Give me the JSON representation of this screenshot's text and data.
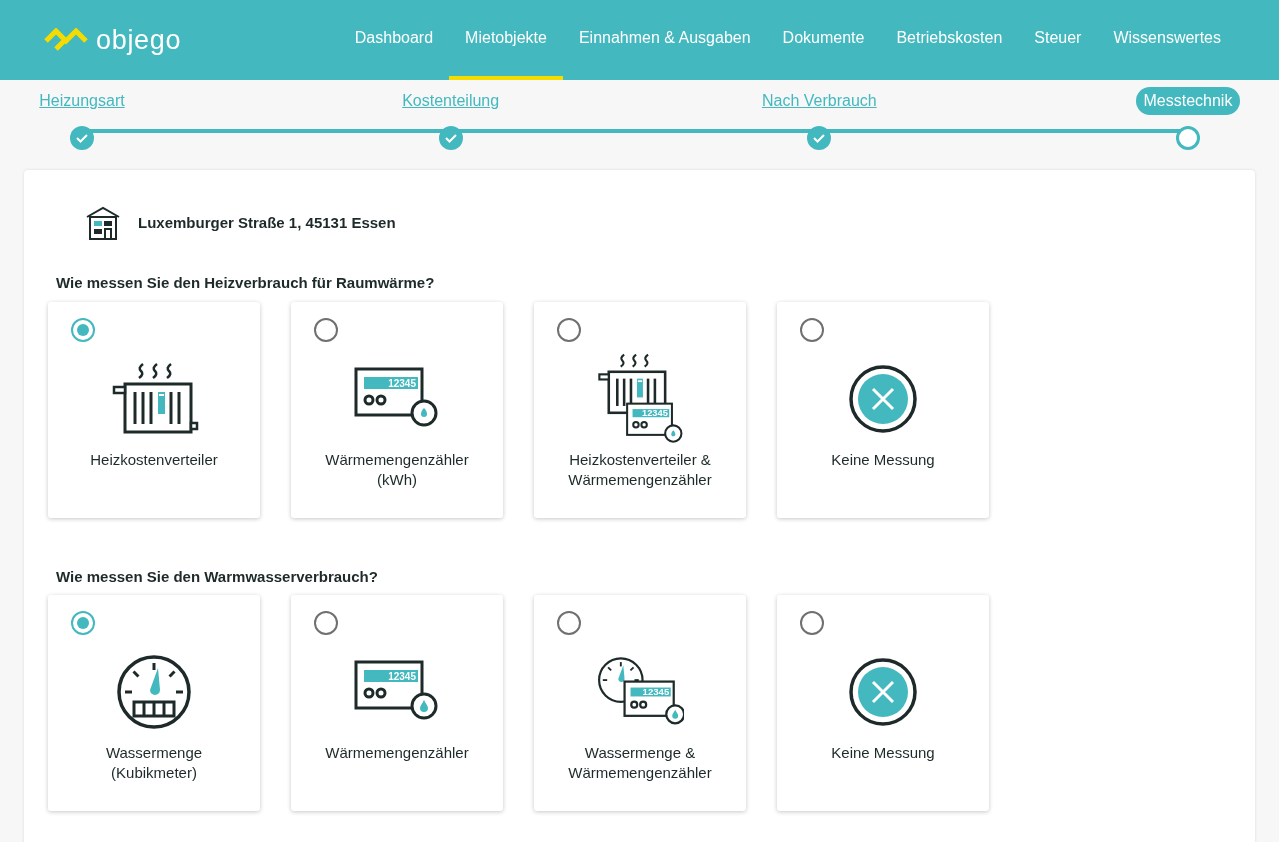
{
  "brand": {
    "name": "objego"
  },
  "nav": [
    {
      "label": "Dashboard",
      "selected": false
    },
    {
      "label": "Mietobjekte",
      "selected": true
    },
    {
      "label": "Einnahmen & Ausgaben",
      "selected": false
    },
    {
      "label": "Dokumente",
      "selected": false
    },
    {
      "label": "Betriebskosten",
      "selected": false
    },
    {
      "label": "Steuer",
      "selected": false
    },
    {
      "label": "Wissenswertes",
      "selected": false
    }
  ],
  "steps": [
    {
      "label": "Heizungsart",
      "completed": true,
      "selected": false
    },
    {
      "label": "Kostenteilung",
      "completed": true,
      "selected": false
    },
    {
      "label": "Nach Verbrauch",
      "completed": true,
      "selected": false
    },
    {
      "label": "Messtechnik",
      "completed": false,
      "selected": true
    }
  ],
  "property": {
    "address": "Luxemburger Straße 1, 45131 Essen"
  },
  "questions": [
    {
      "title": "Wie messen Sie den Heizverbrauch für Raumwärme?",
      "options": [
        {
          "label": "Heizkostenverteiler",
          "kind": "radiator",
          "selected": true
        },
        {
          "label": "Wärmemengenzähler\n(kWh)",
          "kind": "meter-flame",
          "display": "12345",
          "selected": false
        },
        {
          "label": "Heizkostenverteiler &\nWärmemengenzähler",
          "kind": "radiator-meter",
          "display": "12345",
          "selected": false
        },
        {
          "label": "Keine Messung",
          "kind": "none",
          "selected": false
        }
      ]
    },
    {
      "title": "Wie messen Sie den Warmwasserverbrauch?",
      "options": [
        {
          "label": "Wassermenge\n(Kubikmeter)",
          "kind": "gauge",
          "selected": true
        },
        {
          "label": "Wärmemengenzähler",
          "kind": "meter-drop",
          "display": "12345",
          "selected": false
        },
        {
          "label": "Wassermenge &\nWärmemengenzähler",
          "kind": "gauge-meter",
          "display": "12345",
          "selected": false
        },
        {
          "label": "Keine Messung",
          "kind": "none",
          "selected": false
        }
      ]
    }
  ]
}
